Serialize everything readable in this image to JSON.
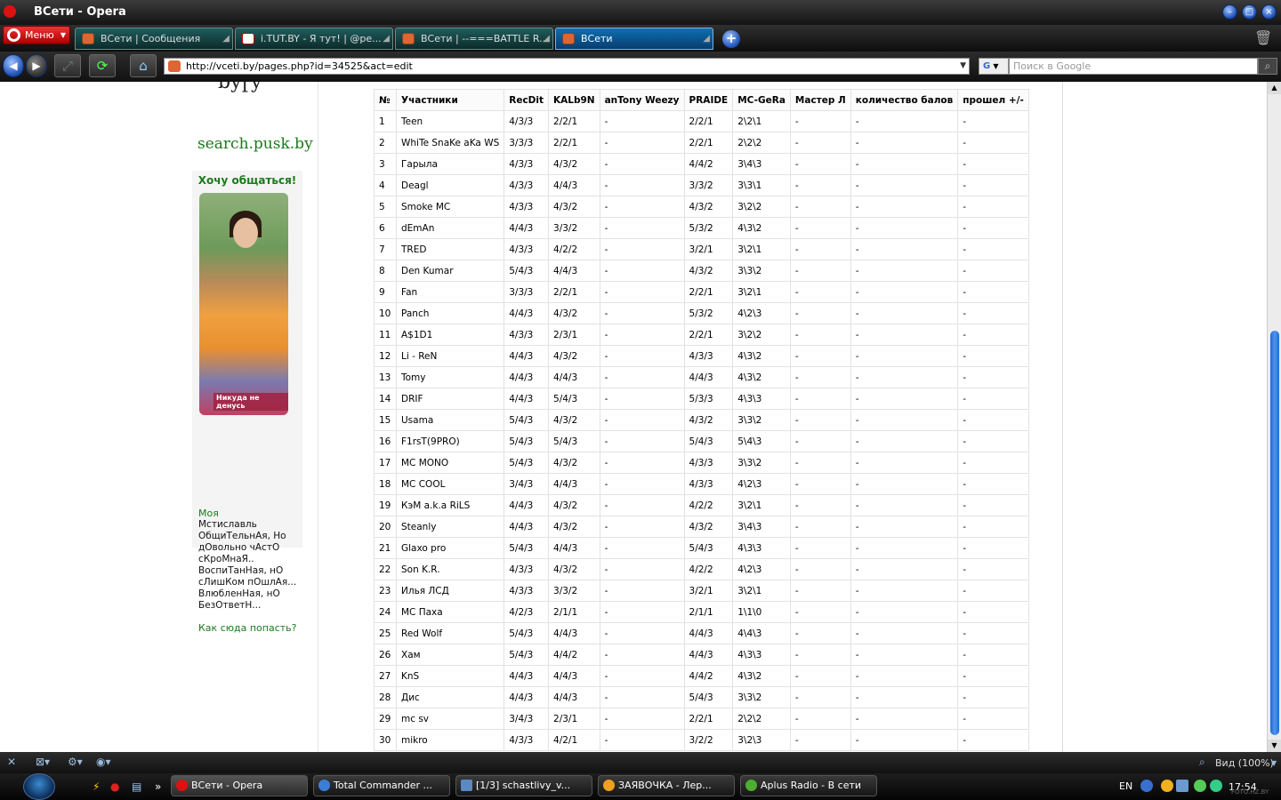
{
  "window": {
    "title": "ВСети - Opera"
  },
  "menu_button": "Меню",
  "tabs": [
    {
      "label": "ВСети | Сообщения",
      "active": false
    },
    {
      "label": "i.TUT.BY - Я тут! | @pe...",
      "active": false
    },
    {
      "label": "ВСети | --===BATTLE R...",
      "active": false
    },
    {
      "label": "ВСети",
      "active": true
    }
  ],
  "address_bar": {
    "url": "http://vceti.by/pages.php?id=34525&act=edit"
  },
  "search_bar": {
    "placeholder": "Поиск в Google"
  },
  "sidebar": {
    "search_link": "search.pusk.by",
    "profile_title": "Хочу общаться!",
    "photo_caption": "Никуда не денусь",
    "name": "Моя",
    "status": "Мстиславль ОбщиТельнАя, Но дОвольно чАстО сКроМнаЯ.. ВоспиТанНая, нО сЛишКом пОшлАя... ВлюбленНая, нО БезОтветН...",
    "howto_link": "Как сюда попасть?"
  },
  "table": {
    "headers": [
      "№",
      "Участники",
      "RecDit",
      "KALb9N",
      "anTony Weezy",
      "PRAIDE",
      "MC-GeRa",
      "Мастер Л",
      "количество балов",
      "прошел +/-"
    ],
    "rows": [
      [
        "1",
        "Teen",
        "4/3/3",
        "2/2/1",
        "-",
        "2/2/1",
        "2\\2\\1",
        "-",
        "-",
        "-"
      ],
      [
        "2",
        "WhiTe SnaKe aKa WS",
        "3/3/3",
        "2/2/1",
        "-",
        "2/2/1",
        "2\\2\\2",
        "-",
        "-",
        "-"
      ],
      [
        "3",
        "Гарыла",
        "4/3/3",
        "4/3/2",
        "-",
        "4/4/2",
        "3\\4\\3",
        "-",
        "-",
        "-"
      ],
      [
        "4",
        "Deagl",
        "4/3/3",
        "4/4/3",
        "-",
        "3/3/2",
        "3\\3\\1",
        "-",
        "-",
        "-"
      ],
      [
        "5",
        "Smoke MC",
        "4/3/3",
        "4/3/2",
        "-",
        "4/3/2",
        "3\\2\\2",
        "-",
        "-",
        "-"
      ],
      [
        "6",
        "dEmAn",
        "4/4/3",
        "3/3/2",
        "-",
        "5/3/2",
        "4\\3\\2",
        "-",
        "-",
        "-"
      ],
      [
        "7",
        "TRED",
        "4/3/3",
        "4/2/2",
        "-",
        "3/2/1",
        "3\\2\\1",
        "-",
        "-",
        "-"
      ],
      [
        "8",
        "Den Kumar",
        "5/4/3",
        "4/4/3",
        "-",
        "4/3/2",
        "3\\3\\2",
        "-",
        "-",
        "-"
      ],
      [
        "9",
        "Fan",
        "3/3/3",
        "2/2/1",
        "-",
        "2/2/1",
        "3\\2\\1",
        "-",
        "-",
        "-"
      ],
      [
        "10",
        "Panch",
        "4/4/3",
        "4/3/2",
        "-",
        "5/3/2",
        "4\\2\\3",
        "-",
        "-",
        "-"
      ],
      [
        "11",
        "A$1D1",
        "4/3/3",
        "2/3/1",
        "-",
        "2/2/1",
        "3\\2\\2",
        "-",
        "-",
        "-"
      ],
      [
        "12",
        "Li - ReN",
        "4/4/3",
        "4/3/2",
        "-",
        "4/3/3",
        "4\\3\\2",
        "-",
        "-",
        "-"
      ],
      [
        "13",
        "Tomy",
        "4/4/3",
        "4/4/3",
        "-",
        "4/4/3",
        "4\\3\\2",
        "-",
        "-",
        "-"
      ],
      [
        "14",
        "DRIF",
        "4/4/3",
        "5/4/3",
        "-",
        "5/3/3",
        "4\\3\\3",
        "-",
        "-",
        "-"
      ],
      [
        "15",
        "Usama",
        "5/4/3",
        "4/3/2",
        "-",
        "4/3/2",
        "3\\3\\2",
        "-",
        "-",
        "-"
      ],
      [
        "16",
        "F1rsT(9PRO)",
        "5/4/3",
        "5/4/3",
        "-",
        "5/4/3",
        "5\\4\\3",
        "-",
        "-",
        "-"
      ],
      [
        "17",
        "MC MONO",
        "5/4/3",
        "4/3/2",
        "-",
        "4/3/3",
        "3\\3\\2",
        "-",
        "-",
        "-"
      ],
      [
        "18",
        "MC COOL",
        "3/4/3",
        "4/4/3",
        "-",
        "4/3/3",
        "4\\2\\3",
        "-",
        "-",
        "-"
      ],
      [
        "19",
        "КэМ a.k.a RiLS",
        "4/4/3",
        "4/3/2",
        "-",
        "4/2/2",
        "3\\2\\1",
        "-",
        "-",
        "-"
      ],
      [
        "20",
        "Steanly",
        "4/4/3",
        "4/3/2",
        "-",
        "4/3/2",
        "3\\4\\3",
        "-",
        "-",
        "-"
      ],
      [
        "21",
        "Glaxo pro",
        "5/4/3",
        "4/4/3",
        "-",
        "5/4/3",
        "4\\3\\3",
        "-",
        "-",
        "-"
      ],
      [
        "22",
        "Son K.R.",
        "4/3/3",
        "4/3/2",
        "-",
        "4/2/2",
        "4\\2\\3",
        "-",
        "-",
        "-"
      ],
      [
        "23",
        "Илья ЛСД",
        "4/3/3",
        "3/3/2",
        "-",
        "3/2/1",
        "3\\2\\1",
        "-",
        "-",
        "-"
      ],
      [
        "24",
        "MC Паха",
        "4/2/3",
        "2/1/1",
        "-",
        "2/1/1",
        "1\\1\\0",
        "-",
        "-",
        "-"
      ],
      [
        "25",
        "Red Wolf",
        "5/4/3",
        "4/4/3",
        "-",
        "4/4/3",
        "4\\4\\3",
        "-",
        "-",
        "-"
      ],
      [
        "26",
        "Хам",
        "5/4/3",
        "4/4/2",
        "-",
        "4/4/3",
        "4\\3\\3",
        "-",
        "-",
        "-"
      ],
      [
        "27",
        "KnS",
        "4/4/3",
        "4/4/3",
        "-",
        "4/4/2",
        "4\\3\\2",
        "-",
        "-",
        "-"
      ],
      [
        "28",
        "Дис",
        "4/4/3",
        "4/4/3",
        "-",
        "5/4/3",
        "3\\3\\2",
        "-",
        "-",
        "-"
      ],
      [
        "29",
        "mc sv",
        "3/4/3",
        "2/3/1",
        "-",
        "2/2/1",
        "2\\2\\2",
        "-",
        "-",
        "-"
      ],
      [
        "30",
        "mikro",
        "4/3/3",
        "4/2/1",
        "-",
        "3/2/2",
        "3\\2\\3",
        "-",
        "-",
        "-"
      ]
    ]
  },
  "status_bar": {
    "zoom": "Вид (100%)"
  },
  "taskbar": {
    "tasks": [
      {
        "label": "ВСети - Opera",
        "color": "#d11",
        "active": true
      },
      {
        "label": "Total Commander ...",
        "color": "#3a7fd5",
        "active": false
      },
      {
        "label": "[1/3] schastlivy_v...",
        "color": "#5a8ac0",
        "active": false
      },
      {
        "label": "ЗАЯВОЧКА - Лер...",
        "color": "#f0a020",
        "active": false
      },
      {
        "label": "Aplus Radio - В сети",
        "color": "#4caf30",
        "active": false
      }
    ],
    "language": "EN",
    "clock": "17:54",
    "watermark": "FOTO.HZ.BY"
  }
}
